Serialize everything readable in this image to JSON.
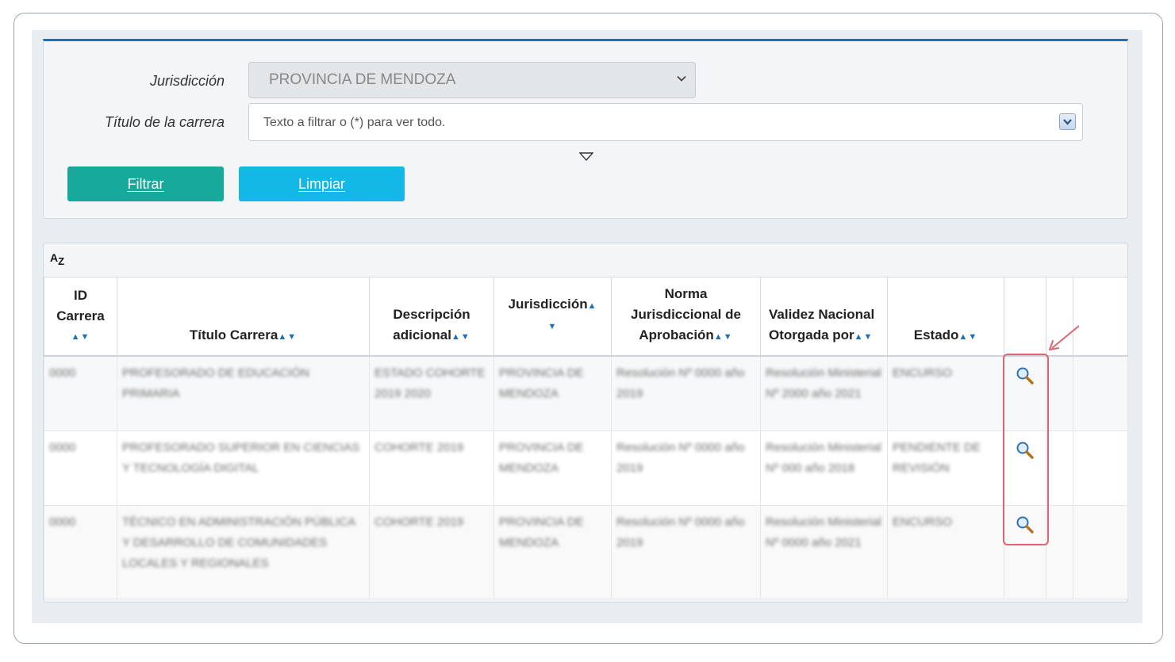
{
  "filters": {
    "jurisdiccion_label": "Jurisdicción",
    "jurisdiccion_value": "PROVINCIA DE MENDOZA",
    "titulo_label": "Título de la carrera",
    "titulo_placeholder": "Texto a filtrar o (*) para ver todo.",
    "filtrar_button": "Filtrar",
    "limpiar_button": "Limpiar"
  },
  "results": {
    "sort_icon_top": "A",
    "sort_icon_sub": "Z",
    "sort_arrows": "▲▼",
    "columns": [
      {
        "line1": "ID",
        "line2": "Carrera"
      },
      {
        "label": "Título Carrera"
      },
      {
        "line1": "Descripción",
        "line2": "adicional"
      },
      {
        "label": "Jurisdicción"
      },
      {
        "line1": "Norma",
        "line2": "Jurisdiccional de",
        "line3": "Aprobación"
      },
      {
        "line1": "Validez Nacional",
        "line2": "Otorgada por"
      },
      {
        "label": "Estado"
      }
    ],
    "rows": [
      {
        "id": "0000",
        "titulo": "PROFESORADO DE EDUCACIÓN PRIMARIA",
        "descripcion": "ESTADO COHORTE 2019 2020",
        "jurisdiccion": "PROVINCIA DE MENDOZA",
        "norma": "Resolución Nº 0000 año 2019",
        "validez": "Resolución Ministerial Nº 2000 año 2021",
        "estado": "ENCURSO"
      },
      {
        "id": "0000",
        "titulo": "PROFESORADO SUPERIOR EN CIENCIAS Y TECNOLOGÍA DIGITAL",
        "descripcion": "COHORTE 2019",
        "jurisdiccion": "PROVINCIA DE MENDOZA",
        "norma": "Resolución Nº 0000 año 2019",
        "validez": "Resolución Ministerial Nº 000 año 2018",
        "estado": "PENDIENTE DE REVISIÓN"
      },
      {
        "id": "0000",
        "titulo": "TÉCNICO EN ADMINISTRACIÓN PÚBLICA Y DESARROLLO DE COMUNIDADES LOCALES Y REGIONALES",
        "descripcion": "COHORTE 2019",
        "jurisdiccion": "PROVINCIA DE MENDOZA",
        "norma": "Resolución Nº 0000 año 2019",
        "validez": "Resolución Ministerial Nº 0000 año 2021",
        "estado": "ENCURSO"
      }
    ]
  },
  "colors": {
    "accent_blue": "#1d6fb8",
    "filtrar_green": "#16a99c",
    "limpiar_cyan": "#13b8e6",
    "highlight_red": "#e06470"
  },
  "icons": {
    "dropdown": "chevron-down-icon",
    "expand": "triangle-down-icon",
    "sort": "sort-az-icon",
    "view": "magnifier-icon",
    "annotation": "arrow-annotation"
  }
}
